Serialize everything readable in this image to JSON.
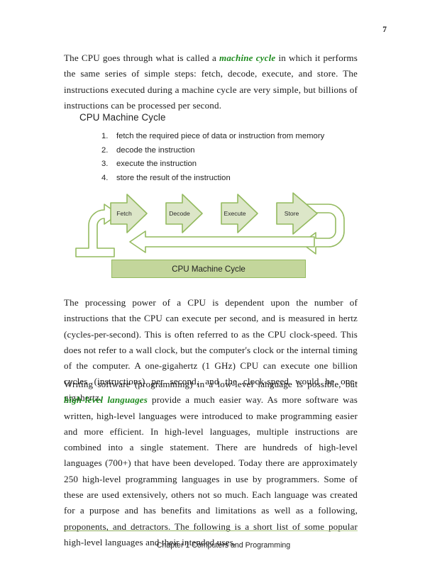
{
  "document": {
    "page_number": "7",
    "footer": "Chapter 1 Computers and Programming",
    "accent_color": "#1f8b1f",
    "diagram_fill": "#dce6c8",
    "diagram_stroke": "#94ba5f",
    "caption_fill": "#c3d69b"
  },
  "paragraphs": {
    "p1_a": "The CPU goes through what is called a ",
    "p1_accent": "machine cycle",
    "p1_b": " in which it performs the same series of simple steps: fetch, decode, execute, and store.  The instructions executed during a machine cycle are very simple, but billions of instructions can be processed per second.",
    "p2": "The processing power of a CPU is dependent upon the number of instructions that the CPU can execute per second, and is measured in hertz (cycles-per-second).  This is often referred to as the CPU clock-speed.  This does not refer to a wall clock, but the computer's clock or the internal timing of the computer. A one-gigahertz (1 GHz) CPU can execute one billion cycles (instructions) per second, and the clock-speed would be one-gigahertz.",
    "p3_a": "Writing software (programming) in a low-level language is possible, but ",
    "p3_accent": "high-level languages",
    "p3_b": " provide a much easier way.  As more software was written, high-level languages were introduced to make programming easier and more efficient.  In high-level languages, multiple instructions are combined into a single statement.  There are hundreds of high-level languages (700+) that have been developed.  Today there are approximately 250 high-level programming languages in use by programmers.  Some of these are used extensively, others not so much.  Each language was created for a purpose and has benefits and limitations as well as a following, proponents, and detractors.  The following is a short list of some popular high-level languages and their intended uses."
  },
  "section": {
    "heading": "CPU Machine Cycle",
    "steps": [
      {
        "num": "1.",
        "text": "fetch the required piece of data or instruction from memory"
      },
      {
        "num": "2.",
        "text": "decode the instruction"
      },
      {
        "num": "3.",
        "text": "execute the instruction"
      },
      {
        "num": "4.",
        "text": "store the result of the instruction"
      }
    ]
  },
  "diagram": {
    "caption": "CPU Machine Cycle",
    "stages": [
      "Fetch",
      "Decode",
      "Execute",
      "Store"
    ]
  }
}
